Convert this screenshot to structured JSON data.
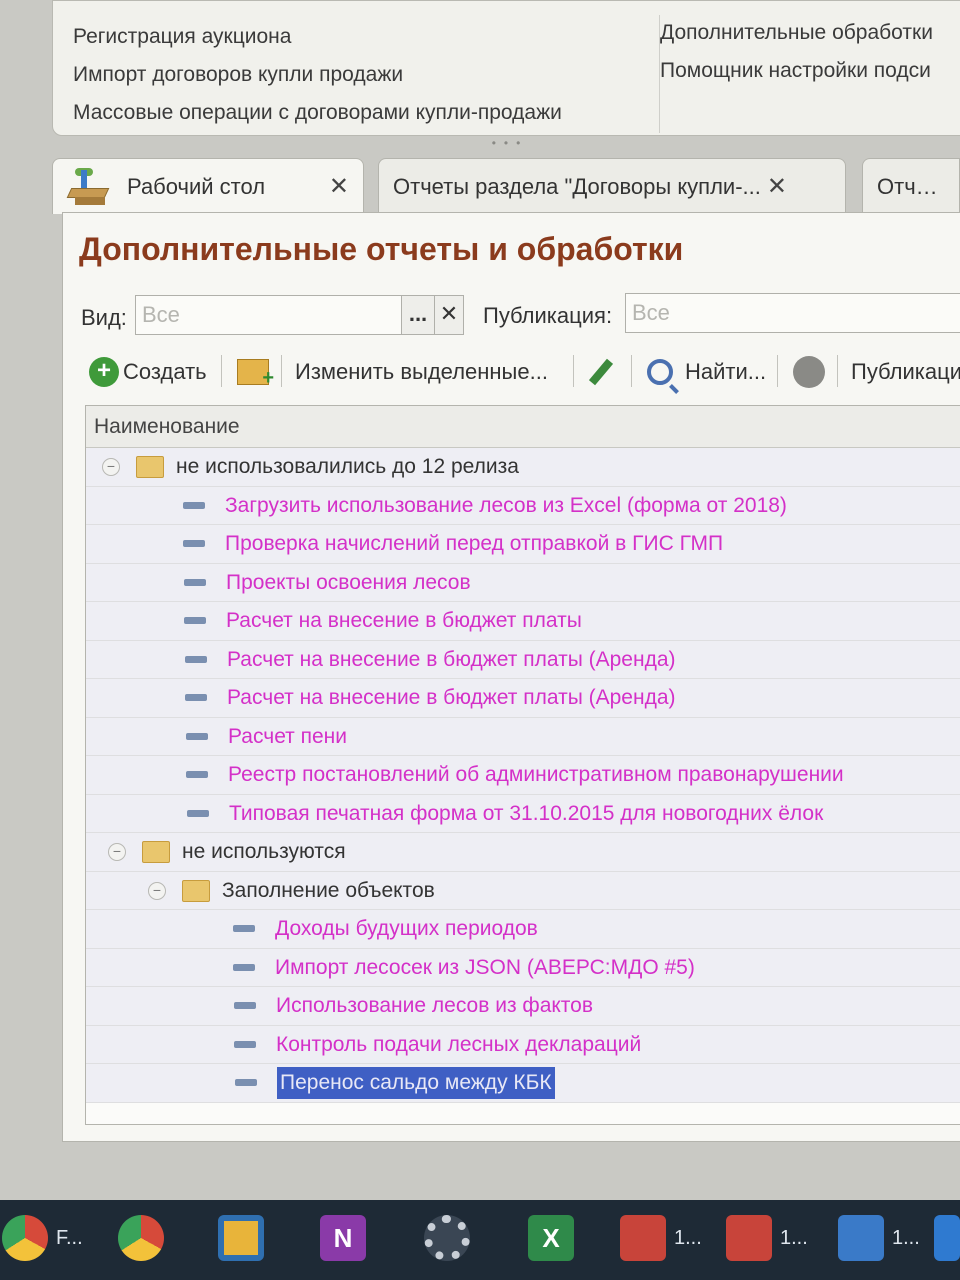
{
  "top_menu": {
    "left_items": [
      "Регистрация аукциона",
      "Импорт договоров купли продажи",
      "Массовые операции с договорами купли-продажи"
    ],
    "right_items": [
      "Дополнительные обработки",
      "Помощник настройки подси"
    ]
  },
  "tabs": [
    {
      "label": "Рабочий стол",
      "close": "✕"
    },
    {
      "label": "Отчеты раздела \"Договоры купли-...",
      "close": "✕"
    },
    {
      "label": "Отчеты"
    }
  ],
  "form": {
    "title": "Дополнительные отчеты и обработки",
    "filter_view_label": "Вид:",
    "filter_view_value": "Все",
    "filter_dots": "...",
    "filter_clear": "✕",
    "filter_pub_label": "Публикация:",
    "filter_pub_value": "Все"
  },
  "toolbar": {
    "create": "Создать",
    "edit_selected": "Изменить выделенные...",
    "find": "Найти...",
    "publication": "Публикаци"
  },
  "table": {
    "column_name": "Наименование",
    "rows": [
      {
        "kind": "group",
        "text": "не использовалились до 12 релиза"
      },
      {
        "kind": "item",
        "text": "Загрузить использование лесов из Excel (форма от 2018)"
      },
      {
        "kind": "item",
        "text": "Проверка начислений перед отправкой в ГИС ГМП"
      },
      {
        "kind": "item",
        "text": "Проекты освоения лесов"
      },
      {
        "kind": "item",
        "text": "Расчет на внесение в бюджет платы"
      },
      {
        "kind": "item",
        "text": "Расчет на внесение в бюджет платы (Аренда)"
      },
      {
        "kind": "item",
        "text": "Расчет на внесение в бюджет платы (Аренда)"
      },
      {
        "kind": "item",
        "text": "Расчет пени"
      },
      {
        "kind": "item",
        "text": "Реестр постановлений об административном правонарушении"
      },
      {
        "kind": "item",
        "text": "Типовая печатная форма от 31.10.2015 для новогодних ёлок"
      },
      {
        "kind": "group",
        "text": "не используются"
      },
      {
        "kind": "group",
        "text": "Заполнение объектов"
      },
      {
        "kind": "item",
        "text": "Доходы будущих периодов"
      },
      {
        "kind": "item",
        "text": "Импорт лесосек из JSON (АВЕРС:МДО #5)"
      },
      {
        "kind": "item",
        "text": "Использование лесов из фактов"
      },
      {
        "kind": "item",
        "text": "Контроль подачи лесных деклараций"
      },
      {
        "kind": "item",
        "text": "Перенос сальдо между КБК",
        "selected": true
      }
    ]
  },
  "taskbar": {
    "items": [
      {
        "label": "F..."
      },
      {
        "label": ""
      },
      {
        "label": ""
      },
      {
        "label": ""
      },
      {
        "label": ""
      },
      {
        "label": ""
      },
      {
        "label": "1..."
      },
      {
        "label": "1..."
      },
      {
        "label": "1..."
      }
    ]
  },
  "colors": {
    "title_color": "#8b3b1d",
    "item_color": "#d430c8",
    "selection_color": "#3f5fc4"
  }
}
